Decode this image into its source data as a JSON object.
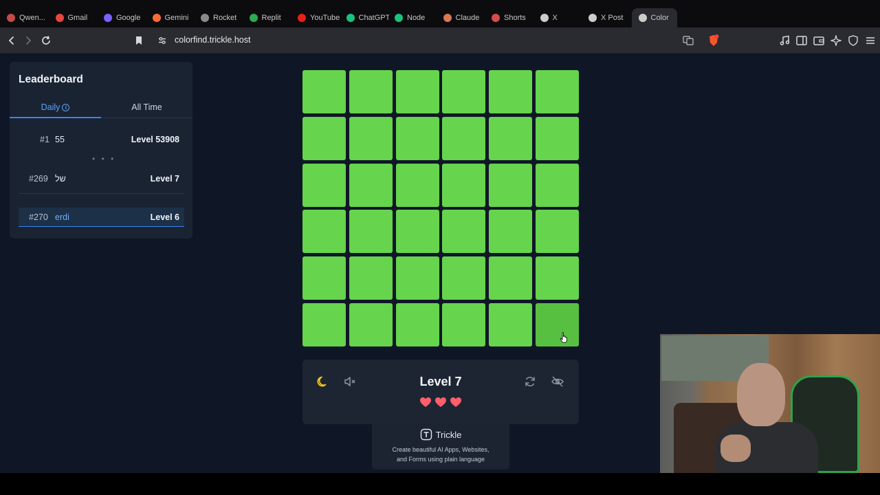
{
  "browser": {
    "tabs": [
      {
        "label": "Qwen...",
        "color": "#c64a4a"
      },
      {
        "label": "Gmail",
        "color": "#e8453c"
      },
      {
        "label": "Google",
        "color": "#7b61ff"
      },
      {
        "label": "Gemini",
        "color": "#ff6b35"
      },
      {
        "label": "Rocket",
        "color": "#8a8a8a"
      },
      {
        "label": "Replit",
        "color": "#2fa84f"
      },
      {
        "label": "YouTube",
        "color": "#e62117"
      },
      {
        "label": "ChatGPT",
        "color": "#19c37d"
      },
      {
        "label": "Node",
        "color": "#19c37d"
      },
      {
        "label": "Claude",
        "color": "#d97757"
      },
      {
        "label": "Shorts",
        "color": "#d64b4b"
      },
      {
        "label": "X",
        "color": "#cccccc"
      },
      {
        "label": "X Post",
        "color": "#cccccc"
      },
      {
        "label": "Color",
        "color": "#cccccc"
      }
    ],
    "url": "colorfind.trickle.host"
  },
  "leaderboard": {
    "title": "Leaderboard",
    "tabs": {
      "daily": "Daily",
      "all_time": "All Time"
    },
    "info_glyph": "i",
    "ellipsis": "• • •",
    "rows": [
      {
        "rank": "#1",
        "name": "55",
        "level": "Level 53908"
      },
      {
        "rank": "#269",
        "name": "של",
        "level": "Level 7"
      },
      {
        "rank": "#270",
        "name": "erdi",
        "level": "Level 6"
      }
    ]
  },
  "game": {
    "grid_size": 6,
    "base_color": "#66d44c",
    "odd_color": "#58c041",
    "odd_cell_index": 35,
    "level_label": "Level 7",
    "lives": 3,
    "heart_color": "#ff5e6b"
  },
  "controls": {
    "theme_icon": "moon-icon",
    "sound_icon": "mute-icon",
    "restart_icon": "restart-icon",
    "hide_icon": "eye-off-icon",
    "moon_color": "#f5c518"
  },
  "branding": {
    "name": "Trickle",
    "tagline_line1": "Create beautiful AI Apps, Websites,",
    "tagline_line2": "and Forms using plain language"
  }
}
